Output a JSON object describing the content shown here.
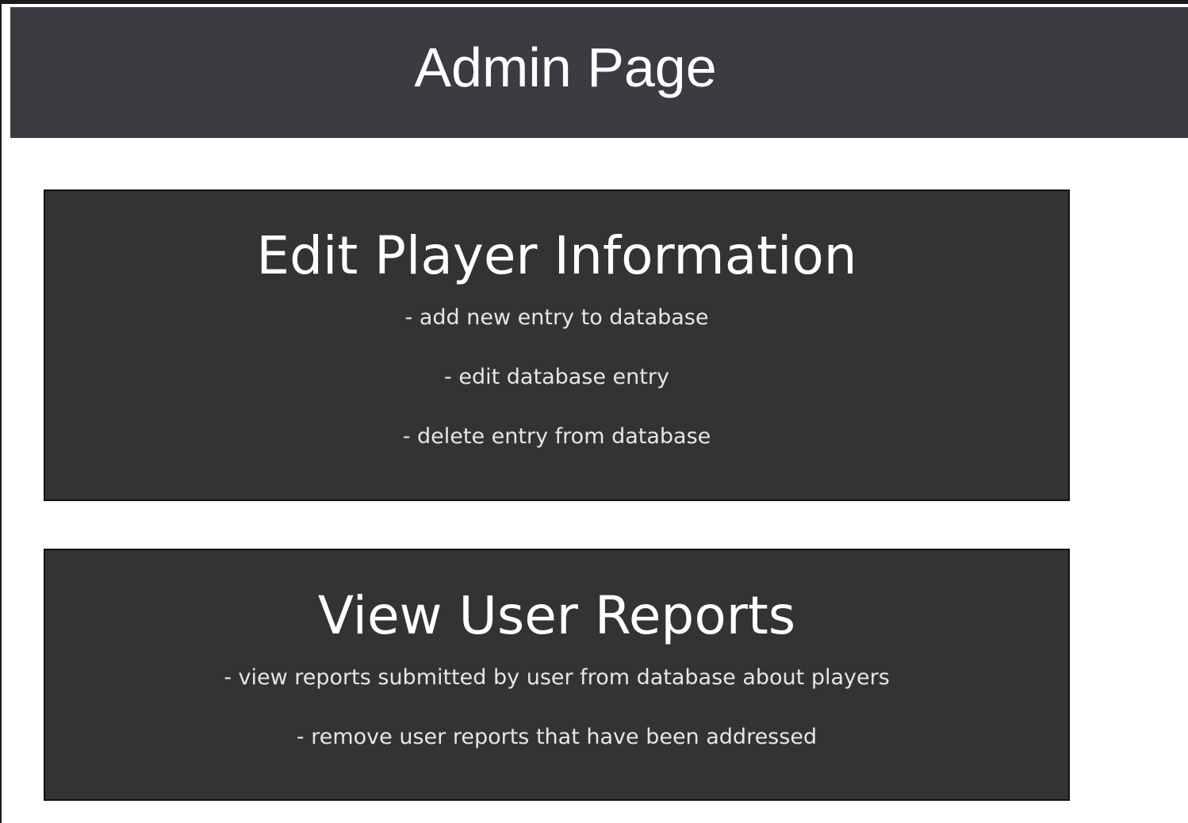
{
  "header": {
    "title": "Admin Page"
  },
  "sections": [
    {
      "title": "Edit Player Information",
      "items": [
        "- add new entry to database",
        "- edit database entry",
        "- delete entry from database"
      ]
    },
    {
      "title": "View User Reports",
      "items": [
        "- view reports submitted by user from database about players",
        "- remove user reports that have been addressed"
      ]
    }
  ],
  "colors": {
    "header_bg": "#3a3c42",
    "card_bg": "#333333",
    "text": "#ffffff"
  }
}
